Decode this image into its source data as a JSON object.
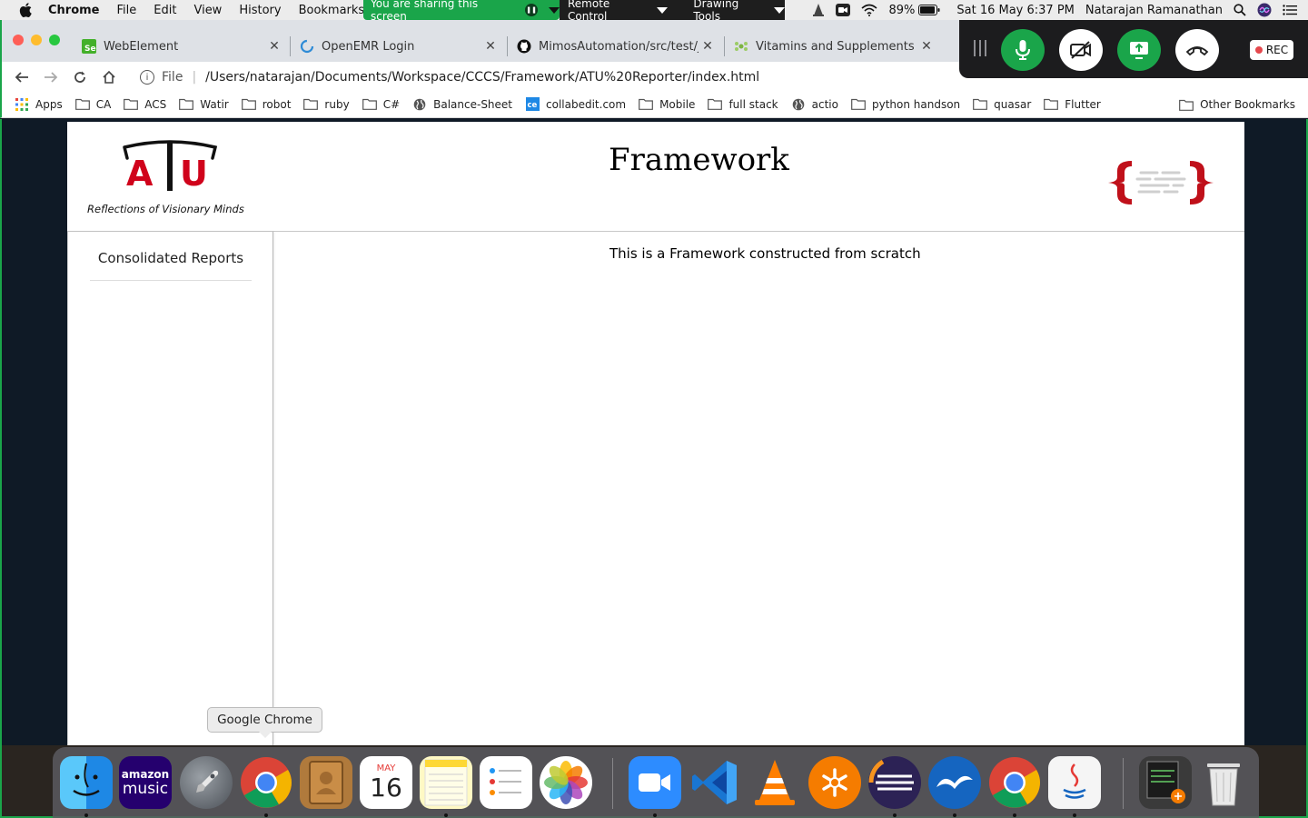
{
  "menubar": {
    "app_name": "Chrome",
    "items": [
      "File",
      "Edit",
      "View",
      "History",
      "Bookmarks"
    ],
    "share_banner": "You are sharing this screen",
    "remote_control": "Remote Control",
    "drawing_tools": "Drawing Tools",
    "battery": "89%",
    "datetime": "Sat 16 May  6:37 PM",
    "user": "Natarajan Ramanathan"
  },
  "tabs": [
    {
      "title": "WebElement",
      "favicon": "selenium-icon"
    },
    {
      "title": "OpenEMR Login",
      "favicon": "openemr-icon"
    },
    {
      "title": "MimosAutomation/src/test/java",
      "favicon": "github-icon"
    },
    {
      "title": "Vitamins and Supplements, Na",
      "favicon": "vitamins-icon"
    }
  ],
  "toolbar": {
    "scheme": "File",
    "url": "/Users/natarajan/Documents/Workspace/CCCS/Framework/ATU%20Reporter/index.html"
  },
  "bookmarks": [
    {
      "label": "Apps",
      "icon": "apps-grid-icon"
    },
    {
      "label": "CA",
      "icon": "folder-icon"
    },
    {
      "label": "ACS",
      "icon": "folder-icon"
    },
    {
      "label": "Watir",
      "icon": "folder-icon"
    },
    {
      "label": "robot",
      "icon": "folder-icon"
    },
    {
      "label": "ruby",
      "icon": "folder-icon"
    },
    {
      "label": "C#",
      "icon": "folder-icon"
    },
    {
      "label": "Balance-Sheet",
      "icon": "globe-icon"
    },
    {
      "label": "collabedit.com",
      "icon": "collabedit-icon"
    },
    {
      "label": "Mobile",
      "icon": "folder-icon"
    },
    {
      "label": "full stack",
      "icon": "folder-icon"
    },
    {
      "label": "actio",
      "icon": "globe-icon"
    },
    {
      "label": "python handson",
      "icon": "folder-icon"
    },
    {
      "label": "quasar",
      "icon": "folder-icon"
    },
    {
      "label": "Flutter",
      "icon": "folder-icon"
    }
  ],
  "bookmarks_other": "Other Bookmarks",
  "zoom": {
    "rec_label": "REC",
    "colors": {
      "green": "#1aa54a",
      "bar": "#1c1c1e"
    }
  },
  "page": {
    "logo_text": "ATU",
    "tagline": "Reflections of Visionary Minds",
    "title": "Framework",
    "sidebar_link": "Consolidated Reports",
    "main_text": "This is a Framework constructed from scratch"
  },
  "dock": {
    "tooltip": "Google Chrome",
    "calendar_month": "MAY",
    "calendar_day": "16",
    "amazon_top": "amazon",
    "amazon_bottom": "music"
  }
}
